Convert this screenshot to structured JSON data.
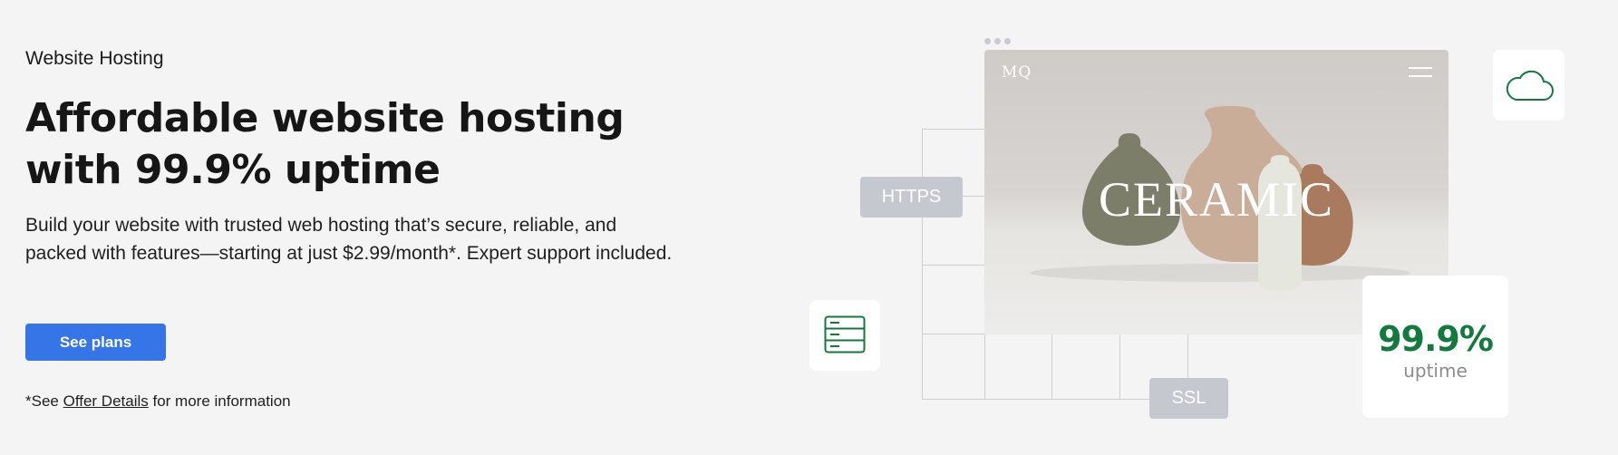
{
  "hero": {
    "eyebrow": "Website Hosting",
    "headline": "Affordable website hosting with 99.9% uptime",
    "description": "Build your website with trusted web hosting that’s secure, reliable, and packed with features—starting at just $2.99/month*. Expert support included.",
    "cta_label": "See plans",
    "footnote_prefix": "*See ",
    "footnote_link": "Offer Details",
    "footnote_suffix": " for more information"
  },
  "illustration": {
    "site_logo": "MQ",
    "site_title": "CERAMIC",
    "https_tag": "HTTPS",
    "ssl_tag": "SSL",
    "uptime_value": "99.9",
    "uptime_unit": "%",
    "uptime_label": "uptime",
    "icons": [
      "server-icon",
      "cloud-icon",
      "hamburger-menu-icon"
    ],
    "colors": {
      "accent": "#3575e8",
      "uptime_green": "#137a3e",
      "tag_gray": "#c5c8cf",
      "background": "#f4f4f4"
    }
  }
}
